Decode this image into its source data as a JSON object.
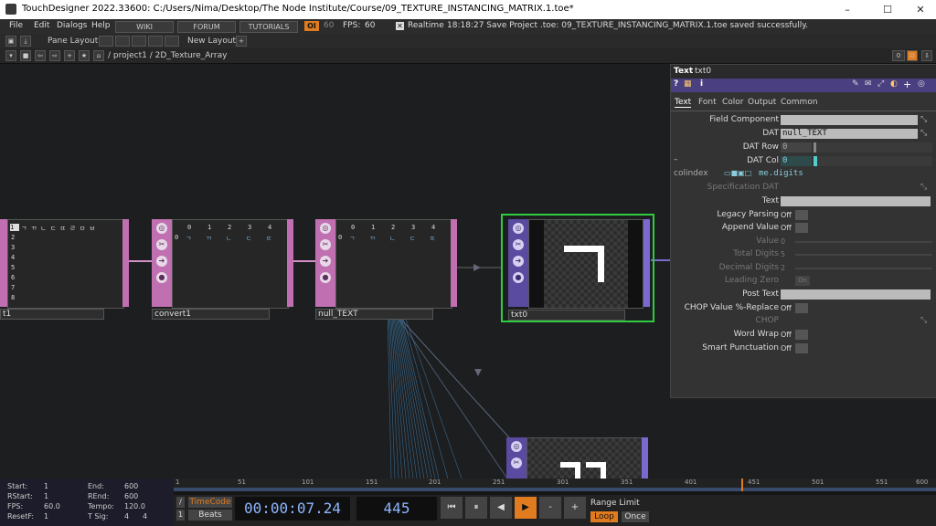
{
  "window": {
    "title": "TouchDesigner 2022.33600: C:/Users/Nima/Desktop/The Node Institute/Course/09_TEXTURE_INSTANCING_MATRIX.1.toe*",
    "minimize": "–",
    "maximize": "☐",
    "close": "✕"
  },
  "menubar": {
    "menus": [
      "File",
      "Edit",
      "Dialogs",
      "Help"
    ],
    "wiki": "WIKI",
    "forum": "FORUM",
    "tutorials": "TUTORIALS",
    "perf_badge": "OI",
    "fps_cap": "60",
    "fps_label": "FPS:",
    "fps_value": "60",
    "realtime_label": "Realtime",
    "status": "18:18:27 Save Project .toe: 09_TEXTURE_INSTANCING_MATRIX.1.toe saved successfully."
  },
  "panebar": {
    "pane_layout": "Pane Layout",
    "new_layout": "New Layout",
    "add": "+"
  },
  "pathbar": {
    "path": "/ project1 / 2D_Texture_Array",
    "counter": "0"
  },
  "nodes": {
    "text1": {
      "label": "t1",
      "rows": [
        "1",
        "2",
        "3",
        "4",
        "5",
        "6",
        "7",
        "8"
      ],
      "row1_chars": "ㄱ ㄲ ㄴ ㄷ ㄸ ㄹ ㅁ ㅂ"
    },
    "convert1": {
      "label": "convert1",
      "cols": [
        "0",
        "1",
        "2",
        "3",
        "4"
      ],
      "row0": [
        "ㄱ",
        "ㄲ",
        "ㄴ",
        "ㄷ",
        "ㄸ"
      ]
    },
    "null_text": {
      "label": "null_TEXT",
      "cols": [
        "0",
        "1",
        "2",
        "3",
        "4"
      ],
      "row0": [
        "ㄱ",
        "ㄲ",
        "ㄴ",
        "ㄷ",
        "ㄸ"
      ]
    },
    "txt0": {
      "label": "txt0"
    }
  },
  "params": {
    "op_type": "Text",
    "op_name": "txt0",
    "tabs": [
      "Text",
      "Font",
      "Color",
      "Output",
      "Common"
    ],
    "rows": [
      {
        "label": "Field Component",
        "kind": "field",
        "value": ""
      },
      {
        "label": "DAT",
        "kind": "field",
        "value": "null_TEXT"
      },
      {
        "label": "DAT Row",
        "kind": "slider",
        "value": "0"
      },
      {
        "label": "DAT Col",
        "kind": "slider",
        "value": "0"
      },
      {
        "label": "colindex",
        "kind": "expr",
        "value": "me.digits"
      },
      {
        "label": "Specification DAT",
        "kind": "dim",
        "value": ""
      },
      {
        "label": "Text",
        "kind": "field",
        "value": ""
      },
      {
        "label": "Legacy Parsing",
        "kind": "toggle",
        "value": "Off"
      },
      {
        "label": "Append Value",
        "kind": "toggle",
        "value": "Off"
      },
      {
        "label": "Value",
        "kind": "dimslider",
        "value": "0"
      },
      {
        "label": "Total Digits",
        "kind": "dimslider",
        "value": "5"
      },
      {
        "label": "Decimal Digits",
        "kind": "dimslider",
        "value": "2"
      },
      {
        "label": "Leading Zero",
        "kind": "dimtoggle",
        "value": "On"
      },
      {
        "label": "Post Text",
        "kind": "field",
        "value": ""
      },
      {
        "label": "CHOP Value %-Replace",
        "kind": "toggle",
        "value": "Off"
      },
      {
        "label": "CHOP",
        "kind": "dim",
        "value": ""
      },
      {
        "label": "Word Wrap",
        "kind": "toggle",
        "value": "Off"
      },
      {
        "label": "Smart Punctuation",
        "kind": "toggle",
        "value": "Off"
      }
    ]
  },
  "timeinfo": {
    "start_label": "Start:",
    "start": "1",
    "end_label": "End:",
    "end": "600",
    "rstart_label": "RStart:",
    "rstart": "1",
    "rend_label": "REnd:",
    "rend": "600",
    "fps_label": "FPS:",
    "fps": "60.0",
    "tempo_label": "Tempo:",
    "tempo": "120.0",
    "resetf_label": "ResetF:",
    "resetf": "1",
    "tsig_label": "T Sig:",
    "tsig_a": "4",
    "tsig_b": "4"
  },
  "timeline": {
    "ticks": [
      "1",
      "51",
      "101",
      "151",
      "201",
      "251",
      "301",
      "351",
      "401",
      "451",
      "501",
      "551",
      "600"
    ]
  },
  "transport": {
    "timecode_btn": "TimeCode",
    "beats_btn": "Beats",
    "timecode": "00:00:07.24",
    "frame": "445",
    "range_limit": "Range Limit",
    "loop": "Loop",
    "once": "Once",
    "btn_start": "⏮",
    "btn_pause": "⏸",
    "btn_back": "◀",
    "btn_play": "▶",
    "btn_minus": "-",
    "btn_plus": "+"
  },
  "colors": {
    "accent_orange": "#e07b1f",
    "text_op_purple": "#5a4aa0",
    "dat_op_pink": "#c070b0",
    "selected_green": "#2ecc40"
  }
}
